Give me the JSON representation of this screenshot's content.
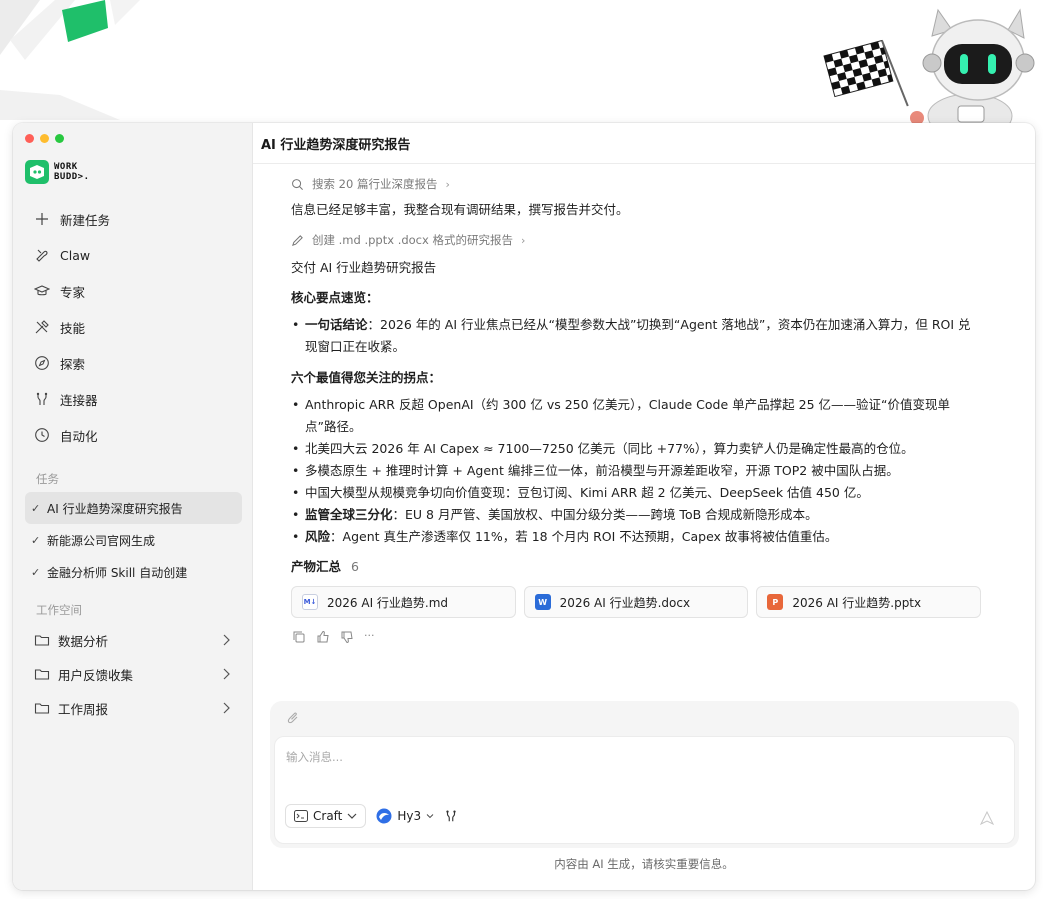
{
  "app": {
    "logo_text_line1": "WORK",
    "logo_text_line2": "BUDD>."
  },
  "colors": {
    "accent_green": "#1fbf6a",
    "active_bg": "#e4e4e4"
  },
  "sidebar": {
    "nav": [
      {
        "label": "新建任务",
        "icon": "plus-icon"
      },
      {
        "label": "Claw",
        "icon": "claw-icon"
      },
      {
        "label": "专家",
        "icon": "graduation-cap-icon"
      },
      {
        "label": "技能",
        "icon": "tools-icon"
      },
      {
        "label": "探索",
        "icon": "compass-icon"
      },
      {
        "label": "连接器",
        "icon": "connector-icon"
      },
      {
        "label": "自动化",
        "icon": "clock-icon"
      }
    ],
    "tasks_label": "任务",
    "tasks": [
      {
        "label": "AI 行业趋势深度研究报告"
      },
      {
        "label": "新能源公司官网生成"
      },
      {
        "label": "金融分析师 Skill 自动创建"
      }
    ],
    "workspace_label": "工作空间",
    "workspaces": [
      {
        "label": "数据分析"
      },
      {
        "label": "用户反馈收集"
      },
      {
        "label": "工作周报"
      }
    ]
  },
  "main": {
    "title": "AI 行业趋势深度研究报告",
    "step1": "搜索 20 篇行业深度报告",
    "line1": "信息已经足够丰富，我整合现有调研结果，撰写报告并交付。",
    "step2": "创建 .md .pptx .docx 格式的研究报告",
    "deliver": "交付 AI 行业趋势研究报告",
    "core_title": "核心要点速览：",
    "one_liner_label": "一句话结论",
    "one_liner_text": "：2026 年的 AI 行业焦点已经从“模型参数大战”切换到“Agent 落地战”，资本仍在加速涌入算力，但 ROI 兑现窗口正在收紧。",
    "six_title": "六个最值得您关注的拐点：",
    "points": [
      {
        "lead": "",
        "text": "Anthropic ARR 反超 OpenAI（约 300 亿 vs 250 亿美元），Claude Code 单产品撑起 25 亿——验证“价值变现单点”路径。"
      },
      {
        "lead": "",
        "text": "北美四大云 2026 年 AI Capex ≈ 7100—7250 亿美元（同比 +77%），算力卖铲人仍是确定性最高的仓位。"
      },
      {
        "lead": "",
        "text": "多模态原生 + 推理时计算 + Agent 编排三位一体，前沿模型与开源差距收窄，开源 TOP2 被中国队占据。"
      },
      {
        "lead": "",
        "text": "中国大模型从规模竞争切向价值变现：豆包订阅、Kimi ARR 超 2 亿美元、DeepSeek 估值 450 亿。"
      },
      {
        "lead": "监管全球三分化",
        "text": "：EU 8 月严管、美国放权、中国分级分类——跨境 ToB 合规成新隐形成本。"
      },
      {
        "lead": "风险",
        "text": "：Agent 真生产渗透率仅 11%，若 18 个月内 ROI 不达预期，Capex 故事将被估值重估。"
      }
    ],
    "outputs_label": "产物汇总",
    "outputs_count": "6",
    "files": [
      {
        "name": "2026 AI 行业趋势.md",
        "icon": "markdown-icon"
      },
      {
        "name": "2026 AI 行业趋势.docx",
        "icon": "word-icon"
      },
      {
        "name": "2026 AI 行业趋势.pptx",
        "icon": "powerpoint-icon"
      }
    ],
    "actions_more": "···"
  },
  "composer": {
    "placeholder": "输入消息...",
    "mode_label": "Craft",
    "model_label": "Hy3",
    "disclaimer": "内容由 AI 生成，请核实重要信息。"
  }
}
